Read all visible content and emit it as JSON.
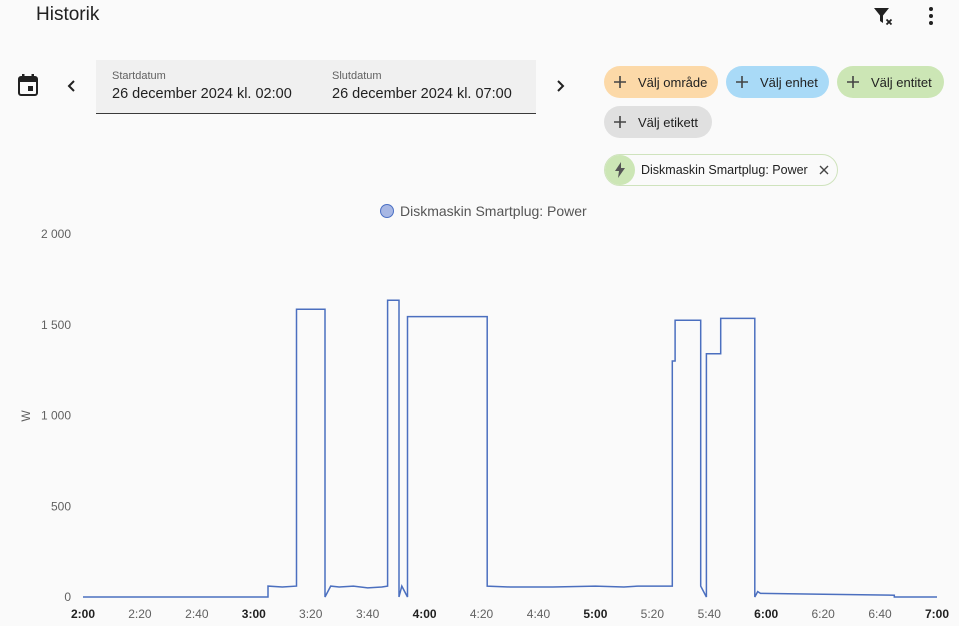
{
  "header": {
    "title": "Historik"
  },
  "icons": {
    "filter_clear": "filter-remove-icon",
    "more": "dots-vertical-icon",
    "calendar": "calendar-icon"
  },
  "date_range": {
    "start_label": "Startdatum",
    "start_value": "26 december 2024 kl. 02:00",
    "end_label": "Slutdatum",
    "end_value": "26 december 2024 kl. 07:00"
  },
  "target_chips": {
    "area": "Välj område",
    "device": "Välj enhet",
    "entity": "Välj entitet",
    "label": "Välj etikett"
  },
  "selected_entity": {
    "name": "Diskmaskin Smartplug: Power",
    "icon": "flash-icon"
  },
  "colors": {
    "line": "#4b6fbf",
    "area_chip": "#fcd9a8",
    "device_chip": "#a9daf7",
    "entity_chip": "#cce6b5",
    "label_chip": "#e0e0e0"
  },
  "chart_data": {
    "type": "line",
    "title": "",
    "legend": [
      "Diskmaskin Smartplug: Power"
    ],
    "ylabel": "W",
    "ylim": [
      0,
      2000
    ],
    "yticks": [
      0,
      500,
      1000,
      1500,
      2000
    ],
    "ytick_labels": [
      "0",
      "500",
      "1 000",
      "1 500",
      "2 000"
    ],
    "xlim": [
      "02:00",
      "07:00"
    ],
    "xticks": [
      "2:00",
      "2:20",
      "2:40",
      "3:00",
      "3:20",
      "3:40",
      "4:00",
      "4:20",
      "4:40",
      "5:00",
      "5:20",
      "5:40",
      "6:00",
      "6:20",
      "6:40",
      "7:00"
    ],
    "xticks_bold": [
      "2:00",
      "3:00",
      "4:00",
      "5:00",
      "6:00",
      "7:00"
    ],
    "series": [
      {
        "name": "Diskmaskin Smartplug: Power",
        "step": true,
        "points": [
          [
            "02:00",
            0
          ],
          [
            "03:05",
            0
          ],
          [
            "03:05",
            60
          ],
          [
            "03:10",
            55
          ],
          [
            "03:15",
            60
          ],
          [
            "03:15",
            1585
          ],
          [
            "03:25",
            1585
          ],
          [
            "03:25",
            0
          ],
          [
            "03:27",
            60
          ],
          [
            "03:30",
            55
          ],
          [
            "03:35",
            60
          ],
          [
            "03:40",
            50
          ],
          [
            "03:45",
            55
          ],
          [
            "03:47",
            60
          ],
          [
            "03:47",
            1635
          ],
          [
            "03:51",
            1635
          ],
          [
            "03:51",
            0
          ],
          [
            "03:52",
            60
          ],
          [
            "03:54",
            0
          ],
          [
            "03:54",
            1545
          ],
          [
            "04:22",
            1545
          ],
          [
            "04:22",
            60
          ],
          [
            "04:30",
            55
          ],
          [
            "04:45",
            55
          ],
          [
            "05:00",
            60
          ],
          [
            "05:10",
            55
          ],
          [
            "05:15",
            60
          ],
          [
            "05:27",
            60
          ],
          [
            "05:27",
            1300
          ],
          [
            "05:28",
            1300
          ],
          [
            "05:28",
            1525
          ],
          [
            "05:37",
            1525
          ],
          [
            "05:37",
            60
          ],
          [
            "05:39",
            0
          ],
          [
            "05:39",
            1340
          ],
          [
            "05:44",
            1340
          ],
          [
            "05:44",
            1535
          ],
          [
            "05:56",
            1535
          ],
          [
            "05:56",
            0
          ],
          [
            "05:57",
            30
          ],
          [
            "05:58",
            20
          ],
          [
            "06:20",
            15
          ],
          [
            "06:45",
            10
          ],
          [
            "06:45",
            0
          ],
          [
            "07:00",
            0
          ]
        ]
      }
    ]
  }
}
